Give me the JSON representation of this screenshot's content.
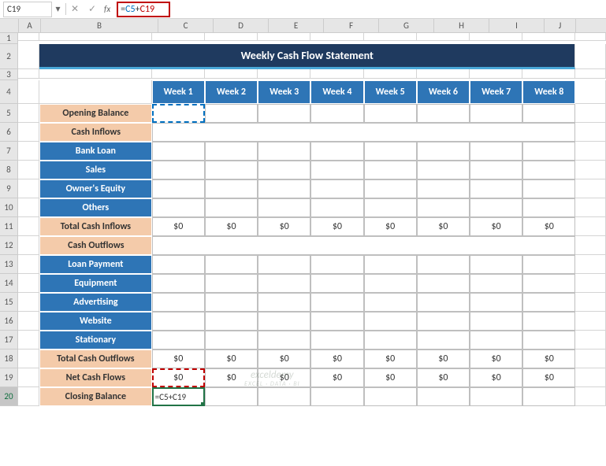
{
  "nameBox": "C19",
  "formula": {
    "prefix": "=",
    "ref1": "C5",
    "op": "+",
    "ref2": "C19"
  },
  "cols": [
    "A",
    "B",
    "C",
    "D",
    "E",
    "F",
    "G",
    "H",
    "I",
    "J"
  ],
  "title": "Weekly Cash Flow Statement",
  "weeks": [
    "Week 1",
    "Week 2",
    "Week 3",
    "Week 4",
    "Week 5",
    "Week 6",
    "Week 7",
    "Week 8"
  ],
  "rows": {
    "r5": "Opening Balance",
    "r6": "Cash Inflows",
    "r7": "Bank Loan",
    "r8": "Sales",
    "r9": "Owner's Equity",
    "r10": "Others",
    "r11": "Total Cash Inflows",
    "r12": "Cash Outflows",
    "r13": "Loan Payment",
    "r14": "Equipment",
    "r15": "Advertising",
    "r16": "Website",
    "r17": "Stationary",
    "r18": "Total Cash Outflows",
    "r19": "Net Cash Flows",
    "r20": "Closing Balance"
  },
  "zero": "$0",
  "inlineEdit": "=C5+C19",
  "watermark": {
    "l1": "exceldemy",
    "l2": "EXCEL · DATA · BI"
  },
  "chart_data": {
    "type": "table",
    "title": "Weekly Cash Flow Statement",
    "columns": [
      "Week 1",
      "Week 2",
      "Week 3",
      "Week 4",
      "Week 5",
      "Week 6",
      "Week 7",
      "Week 8"
    ],
    "rows": [
      {
        "label": "Opening Balance",
        "values": [
          null,
          null,
          null,
          null,
          null,
          null,
          null,
          null
        ]
      },
      {
        "label": "Bank Loan",
        "values": [
          null,
          null,
          null,
          null,
          null,
          null,
          null,
          null
        ]
      },
      {
        "label": "Sales",
        "values": [
          null,
          null,
          null,
          null,
          null,
          null,
          null,
          null
        ]
      },
      {
        "label": "Owner's Equity",
        "values": [
          null,
          null,
          null,
          null,
          null,
          null,
          null,
          null
        ]
      },
      {
        "label": "Others",
        "values": [
          null,
          null,
          null,
          null,
          null,
          null,
          null,
          null
        ]
      },
      {
        "label": "Total Cash Inflows",
        "values": [
          0,
          0,
          0,
          0,
          0,
          0,
          0,
          0
        ]
      },
      {
        "label": "Loan Payment",
        "values": [
          null,
          null,
          null,
          null,
          null,
          null,
          null,
          null
        ]
      },
      {
        "label": "Equipment",
        "values": [
          null,
          null,
          null,
          null,
          null,
          null,
          null,
          null
        ]
      },
      {
        "label": "Advertising",
        "values": [
          null,
          null,
          null,
          null,
          null,
          null,
          null,
          null
        ]
      },
      {
        "label": "Website",
        "values": [
          null,
          null,
          null,
          null,
          null,
          null,
          null,
          null
        ]
      },
      {
        "label": "Stationary",
        "values": [
          null,
          null,
          null,
          null,
          null,
          null,
          null,
          null
        ]
      },
      {
        "label": "Total Cash Outflows",
        "values": [
          0,
          0,
          0,
          0,
          0,
          0,
          0,
          0
        ]
      },
      {
        "label": "Net Cash Flows",
        "values": [
          0,
          0,
          0,
          0,
          0,
          0,
          0,
          0
        ]
      },
      {
        "label": "Closing Balance",
        "values": [
          null,
          null,
          null,
          null,
          null,
          null,
          null,
          null
        ]
      }
    ]
  }
}
